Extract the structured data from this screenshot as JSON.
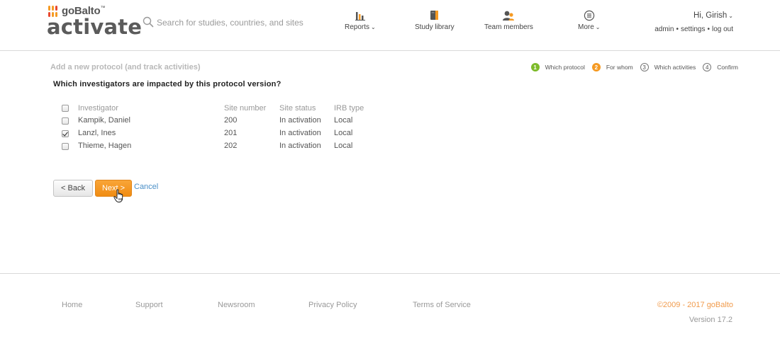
{
  "brand": {
    "company": "goBalto",
    "product": "activate",
    "accent": "#f59a23",
    "green": "#7dbb2a",
    "link_color": "#4a8fc7"
  },
  "header": {
    "search_placeholder": "Search for studies, countries, and sites",
    "nav": [
      {
        "label": "Reports",
        "icon": "bar-chart-icon",
        "has_caret": true
      },
      {
        "label": "Study library",
        "icon": "book-icon",
        "has_caret": false
      },
      {
        "label": "Team members",
        "icon": "people-icon",
        "has_caret": false
      },
      {
        "label": "More",
        "icon": "menu-circle-icon",
        "has_caret": true
      }
    ],
    "user": {
      "greeting": "Hi, Girish",
      "links": [
        "admin",
        "settings",
        "log out"
      ]
    }
  },
  "main": {
    "heading": "Add a new protocol (and track activities)",
    "steps": [
      {
        "num": "1",
        "label": "Which protocol",
        "state": "done"
      },
      {
        "num": "2",
        "label": "For whom",
        "state": "active"
      },
      {
        "num": "3",
        "label": "Which activities",
        "state": "todo"
      },
      {
        "num": "4",
        "label": "Confirm",
        "state": "todo"
      }
    ],
    "question": "Which investigators are impacted by this protocol version?",
    "table": {
      "columns": [
        "Investigator",
        "Site number",
        "Site status",
        "IRB type"
      ],
      "rows": [
        {
          "checked": false,
          "investigator": "Kampik, Daniel",
          "site_number": "200",
          "site_status": "In activation",
          "irb_type": "Local"
        },
        {
          "checked": true,
          "investigator": "Lanzl, Ines",
          "site_number": "201",
          "site_status": "In activation",
          "irb_type": "Local"
        },
        {
          "checked": false,
          "investigator": "Thieme, Hagen",
          "site_number": "202",
          "site_status": "In activation",
          "irb_type": "Local"
        }
      ]
    },
    "buttons": {
      "back": "< Back",
      "next": "Next >",
      "cancel": "Cancel"
    }
  },
  "footer": {
    "links": [
      "Home",
      "Support",
      "Newsroom",
      "Privacy Policy",
      "Terms of Service"
    ],
    "copyright": "©2009 - 2017 goBalto",
    "version": "Version 17.2"
  }
}
